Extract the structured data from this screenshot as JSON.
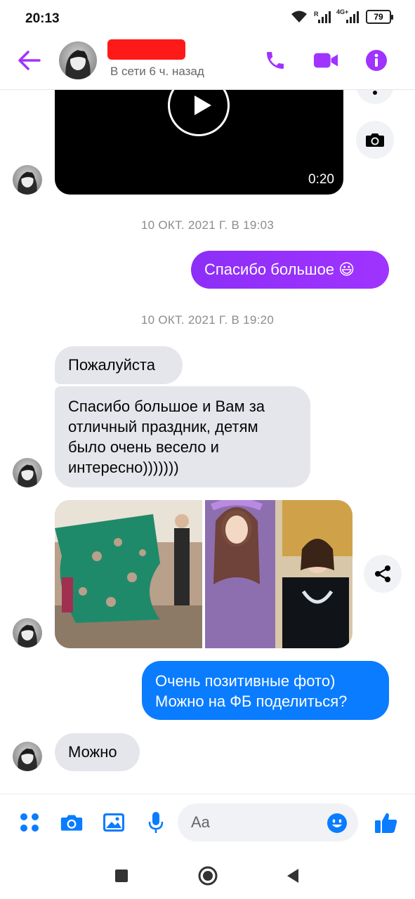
{
  "status_bar": {
    "time": "20:13",
    "network_label": "4G+",
    "battery": "79"
  },
  "header": {
    "presence": "В сети 6 ч. назад"
  },
  "messages": {
    "video_duration": "0:20",
    "timestamp_1": "10 ОКТ. 2021 Г. В 19:03",
    "out_1": "Спасибо большое",
    "out_1_emoji": "😃",
    "timestamp_2": "10 ОКТ. 2021 Г. В 19:20",
    "in_1": "Пожалуйста",
    "in_2_line_1": "Спасибо большое и Вам за",
    "in_2_line_2": "отличный праздник,  детям",
    "in_2_line_3": "было очень весело и",
    "in_2_line_4": "интересно)))))))",
    "out_2_line_1": "Очень позитивные фото)",
    "out_2_line_2": "Можно на ФБ поделиться?",
    "in_3": "Можно"
  },
  "composer": {
    "placeholder": "Aa"
  },
  "colors": {
    "accent_purple": "#a033ff",
    "gradient_purple": "#8c2ff7",
    "blue_bubble": "#0a7cff",
    "incoming_bubble": "#e4e6eb",
    "composer_icons": "#0a7cff"
  },
  "icons": [
    "back-arrow-icon",
    "phone-icon",
    "video-call-icon",
    "info-icon",
    "camera-icon",
    "share-icon",
    "apps-grid-icon",
    "gallery-icon",
    "microphone-icon",
    "emoji-icon",
    "thumbs-up-icon",
    "nav-recents-icon",
    "nav-home-icon",
    "nav-back-icon"
  ]
}
